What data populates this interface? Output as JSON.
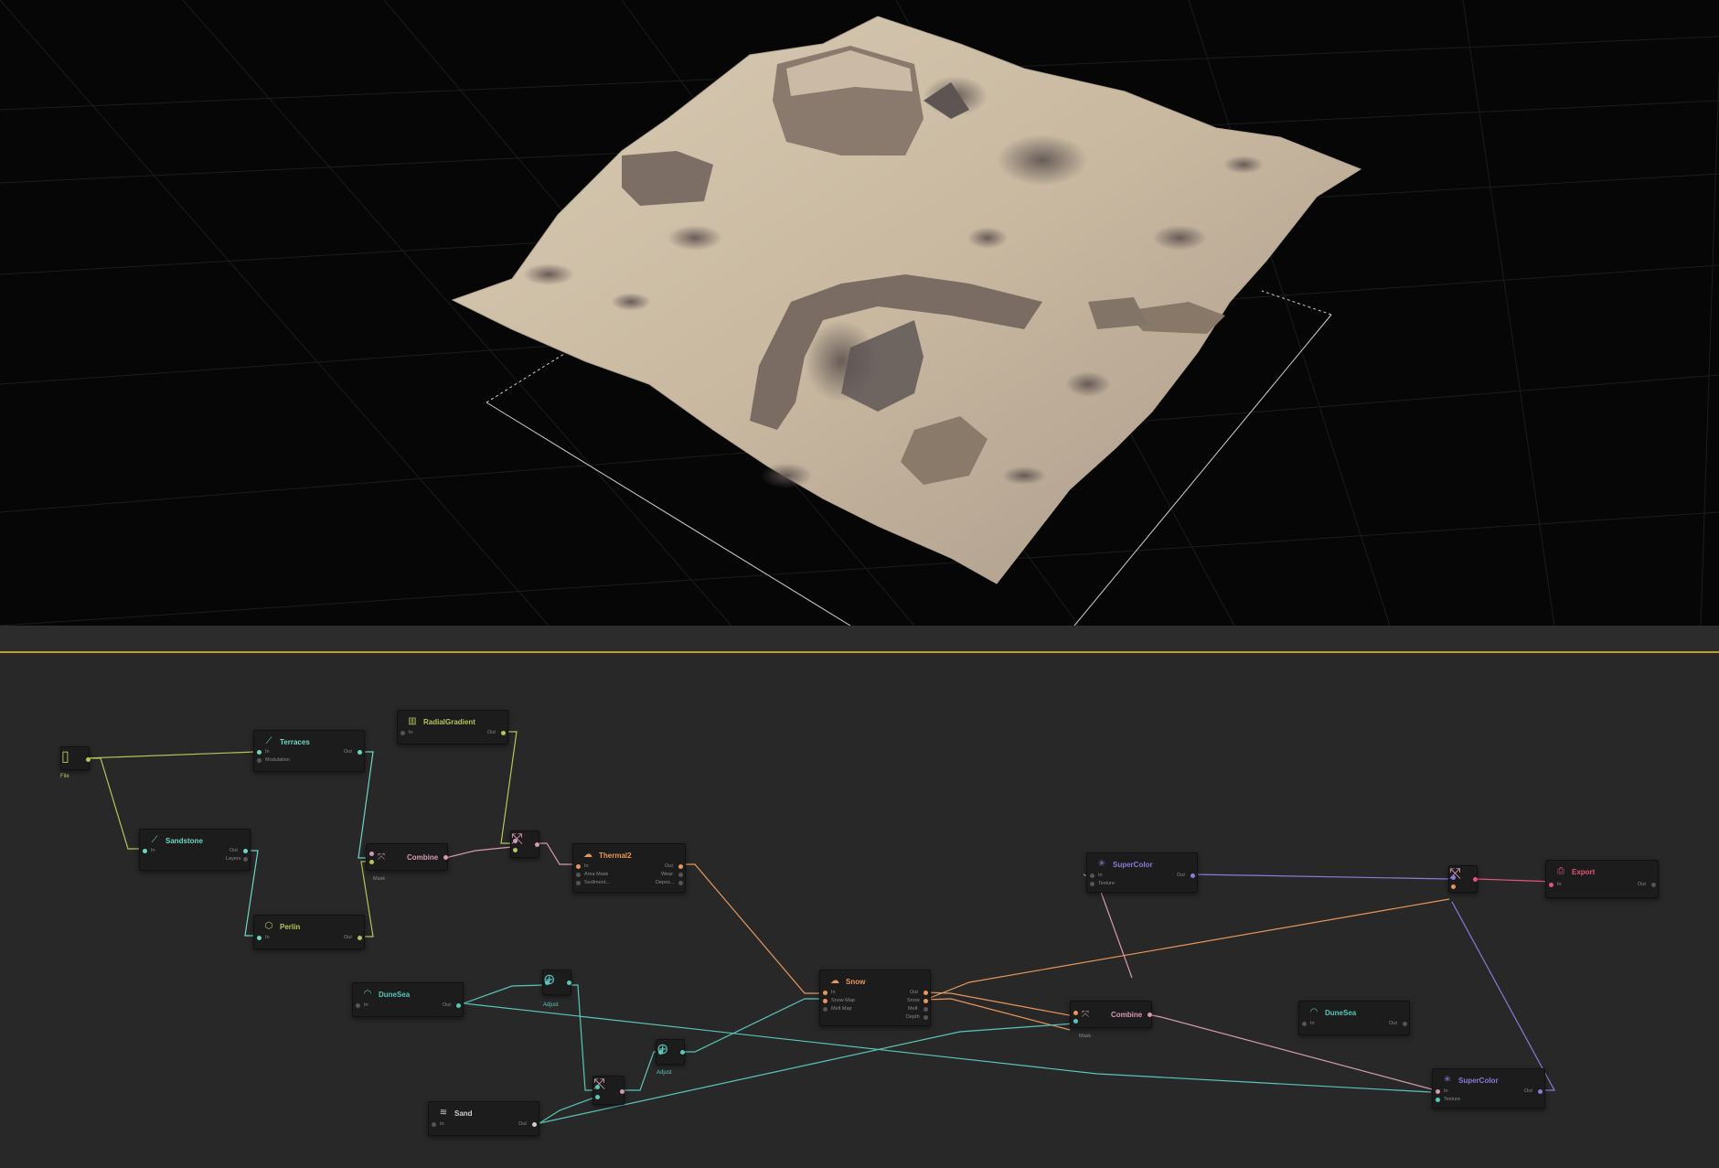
{
  "colors": {
    "viewport_bg": "#060606",
    "graph_bg": "#282828",
    "accent_line": "#b4a238",
    "data_green": "#b8c45a",
    "terrain_green": "#6fd6c0",
    "erosion_orange": "#e8965a",
    "color_purple": "#8b7ad8",
    "output_pink": "#e0567a",
    "combine_pink": "#d59ab4"
  },
  "viewport": {
    "name": "3D terrain preview"
  },
  "graph": {
    "file_node": {
      "label": "File",
      "icon": "file-icon"
    },
    "terraces": {
      "title": "Terraces",
      "in": "In",
      "modulation": "Modulation",
      "out": "Out",
      "icon": "terraces-icon"
    },
    "radial_gradient": {
      "title": "RadialGradient",
      "in": "In",
      "out": "Out",
      "icon": "gradient-icon"
    },
    "sandstone": {
      "title": "Sandstone",
      "in": "In",
      "out": "Out",
      "layers": "Layers",
      "icon": "sandstone-icon"
    },
    "combine1": {
      "title": "Combine",
      "mask": "Mask",
      "icon": "combine-icon"
    },
    "perlin": {
      "title": "Perlin",
      "in": "In",
      "out": "Out",
      "icon": "perlin-icon"
    },
    "thermal2": {
      "title": "Thermal2",
      "in": "In",
      "area_mask": "Area Mask",
      "sediment": "Sediment...",
      "out": "Out",
      "wear": "Wear",
      "deposits": "Depos...",
      "icon": "thermal-icon"
    },
    "dunesea1": {
      "title": "DuneSea",
      "in": "In",
      "out": "Out",
      "icon": "dune-icon"
    },
    "adjust1": {
      "label": "Adjust",
      "icon": "adjust-icon"
    },
    "adjust2": {
      "label": "Adjust",
      "icon": "adjust-icon"
    },
    "sand": {
      "title": "Sand",
      "in": "In",
      "out": "Out",
      "icon": "sand-icon"
    },
    "snow": {
      "title": "Snow",
      "in": "In",
      "snow_map": "Snow Map",
      "melt_map": "Melt Map",
      "out": "Out",
      "snow": "Snow",
      "melt": "Melt",
      "depth": "Depth",
      "icon": "snow-icon"
    },
    "supercolor1": {
      "title": "SuperColor",
      "in": "In",
      "texture": "Texture",
      "out": "Out",
      "icon": "supercolor-icon"
    },
    "combine2": {
      "title": "Combine",
      "mask": "Mask",
      "icon": "combine-icon"
    },
    "dunesea2": {
      "title": "DuneSea",
      "in": "In",
      "out": "Out",
      "icon": "dune-icon"
    },
    "supercolor2": {
      "title": "SuperColor",
      "in": "In",
      "texture": "Texture",
      "out": "Out",
      "icon": "supercolor-icon"
    },
    "export": {
      "title": "Export",
      "in": "In",
      "out": "Out",
      "icon": "export-icon"
    }
  }
}
